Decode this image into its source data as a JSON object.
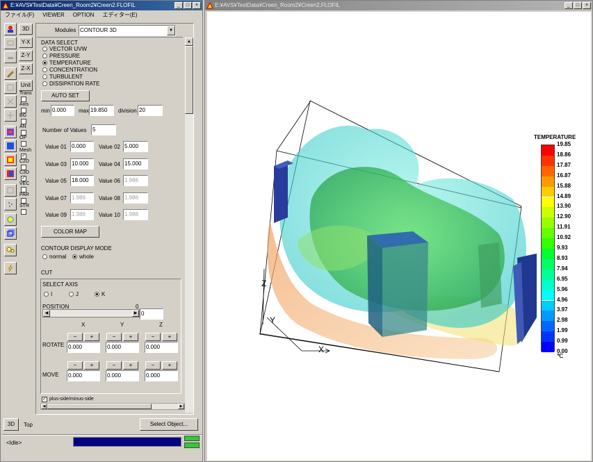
{
  "left_window": {
    "title": "E:¥AVS¥TestData¥Creen_Room2¥Creen2.FLOFIL",
    "menu": [
      "ファイル(F)",
      "VIEWER",
      "OPTION",
      "エディター(E)"
    ],
    "view_buttons": [
      "3D",
      "Y-X",
      "Z-Y",
      "Z-X",
      "Unit",
      "Trans"
    ],
    "toggle_labels": [
      "Axis",
      "BG",
      "AN",
      "OP",
      "Mesh",
      "C2D",
      "C3D",
      "VEC",
      "PAR",
      "STR"
    ]
  },
  "panel": {
    "modules_label": "Modules",
    "modules_value": "CONTOUR 3D",
    "data_select_label": "DATA SELECT",
    "data_options": [
      "VECTOR  UVW",
      "PRESSURE",
      "TEMPERATURE",
      "CONCENTRATION",
      "TURBULENT",
      "DISSIPATION RATE"
    ],
    "data_selected": 2,
    "auto_set": "AUTO SET",
    "min_label": "min",
    "min_value": "0.000",
    "max_label": "max",
    "max_value": "19.850",
    "division_label": "division",
    "division_value": "20",
    "num_values_label": "Number of Values",
    "num_values": "5",
    "values": [
      {
        "label": "Value 01",
        "value": "0.000",
        "enabled": true
      },
      {
        "label": "Value 02",
        "value": "5.000",
        "enabled": true
      },
      {
        "label": "Value 03",
        "value": "10.000",
        "enabled": true
      },
      {
        "label": "Value 04",
        "value": "15.000",
        "enabled": true
      },
      {
        "label": "Value 05",
        "value": "18.000",
        "enabled": true
      },
      {
        "label": "Value 06",
        "value": "1.986",
        "enabled": false
      },
      {
        "label": "Value 07",
        "value": "1.986",
        "enabled": false
      },
      {
        "label": "Value 08",
        "value": "1.986",
        "enabled": false
      },
      {
        "label": "Value 09",
        "value": "1.986",
        "enabled": false
      },
      {
        "label": "Value 10",
        "value": "1.986",
        "enabled": false
      }
    ],
    "color_map": "COLOR MAP",
    "contour_mode_label": "CONTOUR DISPLAY MODE",
    "mode_normal": "normal",
    "mode_whole": "whole",
    "cut_label": "CUT",
    "select_axis_label": "SELECT AXIS",
    "axes": [
      "I",
      "J",
      "K"
    ],
    "position_label": "POSITION",
    "position_max": "0",
    "position_value": "0",
    "col_x": "X",
    "col_y": "Y",
    "col_z": "Z",
    "rotate_label": "ROTATE",
    "move_label": "MOVE",
    "minus": "−",
    "plus": "+",
    "rotate_values": [
      "0.000",
      "0.000",
      "0.000"
    ],
    "move_values": [
      "0.000",
      "0.000",
      "0.000"
    ],
    "plus_side": "plus-side/minus-side"
  },
  "bottom": {
    "view_3d": "3D",
    "top_label": "Top",
    "select_object": "Select Object...",
    "status": "<Idle>"
  },
  "right_window": {
    "title": "E:¥AVS¥TestData¥Creen_Room2¥Creen2.FLOFIL"
  },
  "legend": {
    "title": "TEMPERATURE",
    "unit": "℃",
    "levels": [
      "19.85",
      "18.86",
      "17.87",
      "16.87",
      "15.88",
      "14.89",
      "13.90",
      "12.90",
      "11.91",
      "10.92",
      "9.93",
      "8.93",
      "7.94",
      "6.95",
      "5.96",
      "4.96",
      "3.97",
      "2.98",
      "1.99",
      "0.99",
      "0.00"
    ],
    "colors": [
      "#ff0000",
      "#ff3300",
      "#ff6600",
      "#ff9900",
      "#ffcc00",
      "#ffff00",
      "#ccff00",
      "#99ff00",
      "#66ff00",
      "#33ff00",
      "#00ff33",
      "#00ff66",
      "#00ff99",
      "#00ffcc",
      "#00ffff",
      "#00ccff",
      "#0099ff",
      "#0066ff",
      "#0033ff",
      "#0000ff"
    ]
  },
  "axes_labels": {
    "x": "X",
    "y": "Y",
    "z": "Z"
  }
}
